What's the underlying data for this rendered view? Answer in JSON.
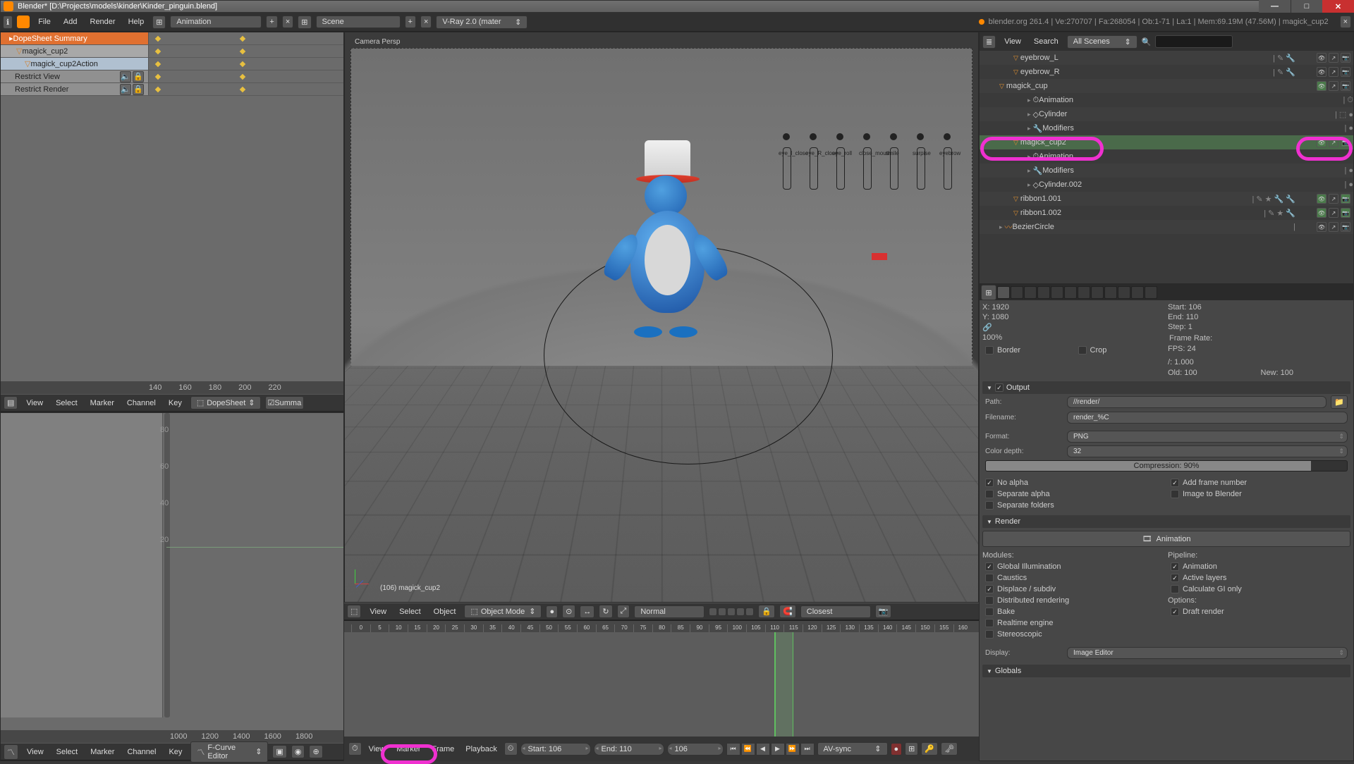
{
  "window": {
    "title": "Blender* [D:\\Projects\\models\\kinder\\Kinder_pinguin.blend]"
  },
  "topmenu": {
    "file": "File",
    "add": "Add",
    "render": "Render",
    "help": "Help",
    "layout": "Animation",
    "scene": "Scene",
    "engine": "V-Ray 2.0 (mater",
    "statusbar": "blender.org 261.4 | Ve:270707 | Fa:268054 | Ob:1-71 | La:1 | Mem:69.19M (47.56M) | magick_cup2"
  },
  "dope": {
    "rows": [
      {
        "label": "DopeSheet Summary",
        "sel": true,
        "icon": "▸"
      },
      {
        "label": "magick_cup2",
        "sel": false,
        "icon": "▽",
        "indent": 1
      },
      {
        "label": "magick_cup2Action",
        "sel": false,
        "icon": "▽",
        "indent": 2,
        "bg": "#98b0c8"
      },
      {
        "label": "Restrict View",
        "sel": false,
        "indent": 2,
        "spk": true
      },
      {
        "label": "Restrict Render",
        "sel": false,
        "indent": 2,
        "spk": true
      }
    ],
    "ruler": [
      "140",
      "160",
      "180",
      "200",
      "220"
    ],
    "menu": {
      "view": "View",
      "select": "Select",
      "marker": "Marker",
      "channel": "Channel",
      "key": "Key",
      "editor": "DopeSheet",
      "filter": "Summa"
    }
  },
  "graph": {
    "menu": {
      "view": "View",
      "select": "Select",
      "marker": "Marker",
      "channel": "Channel",
      "key": "Key",
      "editor": "F-Curve Editor"
    },
    "yticks": [
      "80",
      "60",
      "40",
      "20"
    ],
    "xticks": [
      "1000",
      "1200",
      "1400",
      "1600",
      "1800"
    ]
  },
  "viewport": {
    "camlabel": "Camera Persp",
    "objlabel": "(106) magick_cup2",
    "bones": [
      "eye_l_close",
      "eye_R_close",
      "eye_roll",
      "close_mouth",
      "smile",
      "surpise",
      "eyebrow"
    ],
    "menu": {
      "view": "View",
      "select": "Select",
      "object": "Object",
      "mode": "Object Mode",
      "shading": "Normal",
      "snap": "Closest"
    }
  },
  "timeline": {
    "ticks": [
      "0",
      "5",
      "10",
      "15",
      "20",
      "25",
      "30",
      "35",
      "40",
      "45",
      "50",
      "55",
      "60",
      "65",
      "70",
      "75",
      "80",
      "85",
      "90",
      "95",
      "100",
      "105",
      "110",
      "115",
      "120",
      "125",
      "130",
      "135",
      "140",
      "145",
      "150",
      "155",
      "160"
    ],
    "menu": {
      "view": "View",
      "marker": "Marker",
      "frame": "Frame",
      "playback": "Playback",
      "start": "Start: 106",
      "end": "End: 110",
      "current": "106",
      "sync": "AV-sync"
    }
  },
  "outliner": {
    "hdr": {
      "view": "View",
      "search": "Search",
      "filter": "All Scenes",
      "searchph": ""
    },
    "rows": [
      {
        "label": "eyebrow_L",
        "indent": 2,
        "tri": "▽",
        "icons": [
          "✎",
          "🔧"
        ],
        "vis": [
          "👁",
          "⮕",
          "📷"
        ]
      },
      {
        "label": "eyebrow_R",
        "indent": 2,
        "tri": "▽",
        "icons": [
          "✎",
          "🔧"
        ],
        "vis": [
          "👁",
          "⮕",
          "📷"
        ]
      },
      {
        "label": "magick_cup",
        "indent": 1,
        "tri": "▽",
        "icons": [
          ""
        ],
        "vis": [
          "👁",
          "⮕",
          "📷"
        ],
        "sel": false
      },
      {
        "label": "Animation",
        "indent": 3,
        "tri": "▸",
        "icons": [
          "⏱"
        ],
        "vis": []
      },
      {
        "label": "Cylinder",
        "indent": 3,
        "tri": "▸",
        "icons": [
          "⬚",
          "●"
        ],
        "vis": []
      },
      {
        "label": "Modifiers",
        "indent": 3,
        "tri": "▸",
        "icons": [
          "🔧",
          "●"
        ],
        "vis": []
      },
      {
        "label": "magick_cup2",
        "indent": 2,
        "tri": "▽",
        "icons": [
          ""
        ],
        "vis": [
          "👁",
          "⮕",
          "📷"
        ],
        "sel": true
      },
      {
        "label": "Animation",
        "indent": 3,
        "tri": "▸",
        "icons": [
          "⏱"
        ],
        "vis": []
      },
      {
        "label": "Modifiers",
        "indent": 3,
        "tri": "▸",
        "icons": [
          "🔧",
          "●"
        ],
        "vis": []
      },
      {
        "label": "Cylinder.002",
        "indent": 3,
        "tri": "▸",
        "icons": [
          "⬚",
          "●"
        ],
        "vis": []
      },
      {
        "label": "ribbon1.001",
        "indent": 2,
        "tri": "▽",
        "icons": [
          "✎",
          "★",
          "🔧",
          "🔧"
        ],
        "vis": [
          "👁",
          "⮕",
          "📷"
        ]
      },
      {
        "label": "ribbon1.002",
        "indent": 2,
        "tri": "▽",
        "icons": [
          "✎",
          "★",
          "🔧"
        ],
        "vis": [
          "👁",
          "⮕",
          "📷"
        ]
      },
      {
        "label": "BezierCircle",
        "indent": 1,
        "tri": "▸",
        "icons": [
          "〰"
        ],
        "vis": [
          "👁",
          "⮕",
          "📷"
        ]
      }
    ]
  },
  "props": {
    "dims": {
      "x": "X: 1920",
      "y": "Y: 1080",
      "pct": "100%",
      "start": "Start: 106",
      "end": "End: 110",
      "step": "Step: 1",
      "border": "Border",
      "crop": "Crop",
      "frate": "Frame Rate:",
      "fps": "FPS: 24",
      "tb": "/: 1.000",
      "old": "Old: 100",
      "new": "New: 100"
    },
    "output": {
      "hdr": "Output",
      "path": "Path:",
      "pathval": "//render/",
      "fname": "Filename:",
      "fnameval": "render_%C",
      "format": "Format:",
      "formatval": "PNG",
      "depth": "Color depth:",
      "depthval": "32",
      "compr": "Compression: 90%",
      "noalpha": "No alpha",
      "addframe": "Add frame number",
      "sepalpha": "Separate alpha",
      "imgblend": "Image to Blender",
      "sepfold": "Separate folders"
    },
    "render": {
      "hdr": "Render",
      "anim": "Animation",
      "modules": "Modules:",
      "pipeline": "Pipeline:",
      "gi": "Global Illumination",
      "animp": "Animation",
      "caustics": "Caustics",
      "layers": "Active layers",
      "disp": "Displace / subdiv",
      "calcgi": "Calculate GI only",
      "dist": "Distributed rendering",
      "options": "Options:",
      "bake": "Bake",
      "draft": "Draft render",
      "rt": "Realtime engine",
      "stereo": "Stereoscopic",
      "disp2": "Display:",
      "dispval": "Image Editor"
    },
    "globals": {
      "hdr": "Globals"
    }
  }
}
